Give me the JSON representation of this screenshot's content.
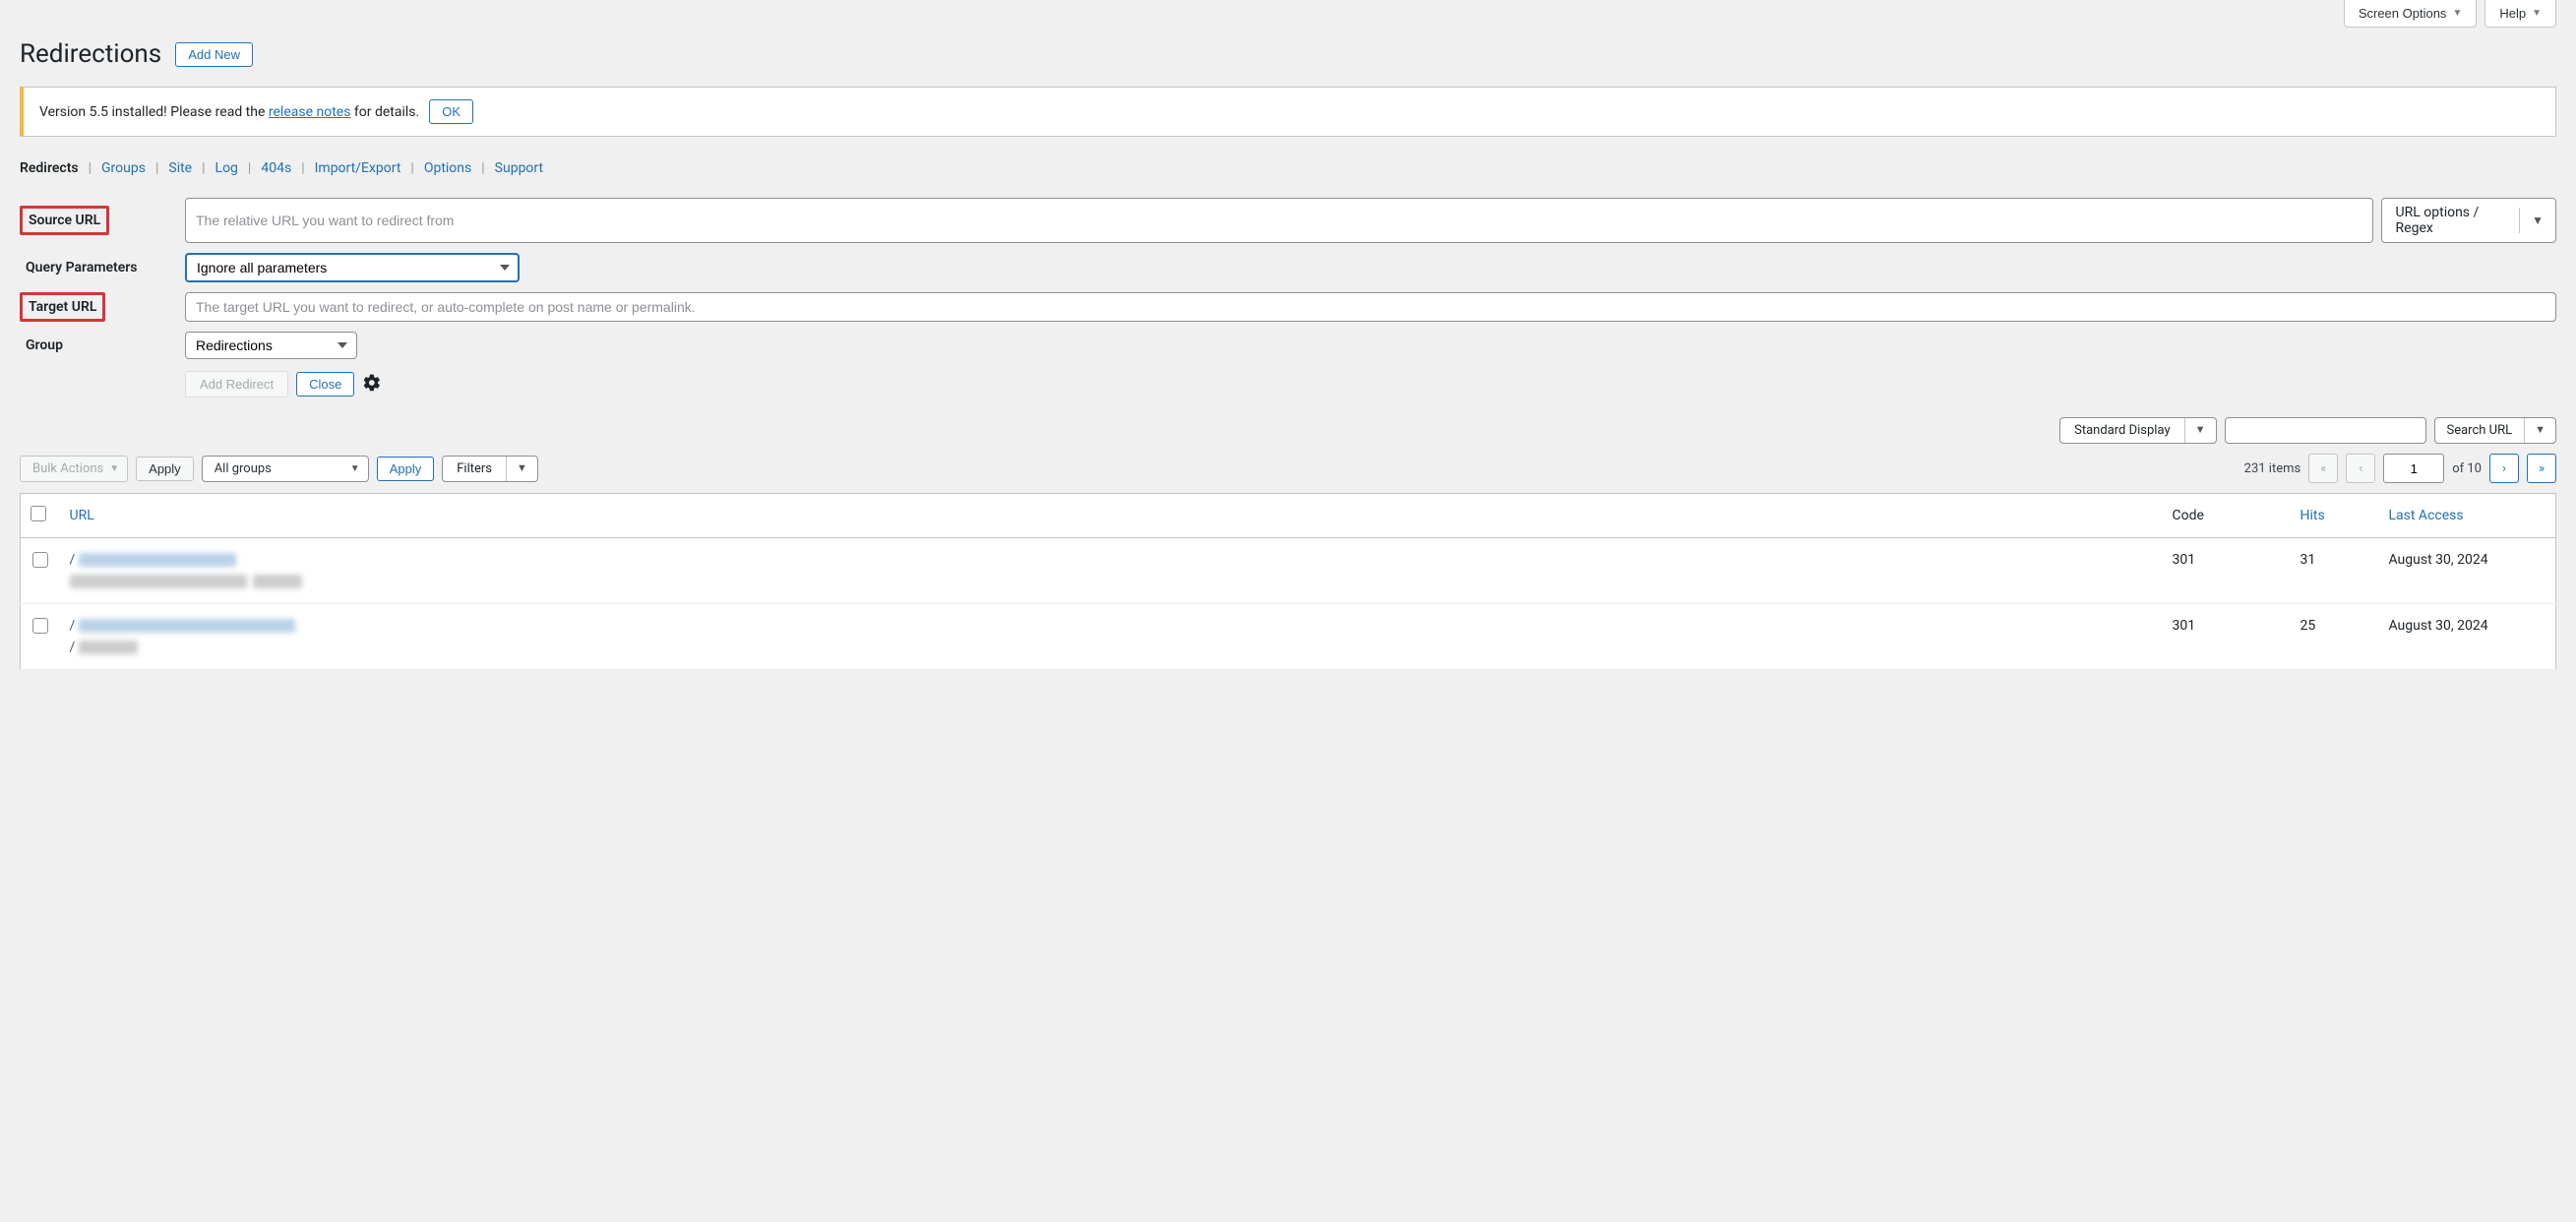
{
  "topTabs": {
    "screenOptions": "Screen Options",
    "help": "Help"
  },
  "header": {
    "title": "Redirections",
    "addNew": "Add New"
  },
  "notice": {
    "prefix": "Version 5.5 installed! Please read the ",
    "link": "release notes",
    "suffix": " for details.",
    "ok": "OK"
  },
  "subnav": [
    "Redirects",
    "Groups",
    "Site",
    "Log",
    "404s",
    "Import/Export",
    "Options",
    "Support"
  ],
  "subnavActive": 0,
  "form": {
    "sourceLabel": "Source URL",
    "sourcePlaceholder": "The relative URL you want to redirect from",
    "urlOptions": "URL options / Regex",
    "queryLabel": "Query Parameters",
    "querySelected": "Ignore all parameters",
    "targetLabel": "Target URL",
    "targetPlaceholder": "The target URL you want to redirect, or auto-complete on post name or permalink.",
    "groupLabel": "Group",
    "groupSelected": "Redirections",
    "addRedirect": "Add Redirect",
    "close": "Close"
  },
  "displayMode": "Standard Display",
  "searchBtn": "Search URL",
  "bulkActions": "Bulk Actions",
  "applyBtn": "Apply",
  "groupsFilter": "All groups",
  "applyFilter": "Apply",
  "filtersBtn": "Filters",
  "pagination": {
    "itemsText": "231 items",
    "page": "1",
    "ofText": "of 10"
  },
  "table": {
    "headers": {
      "url": "URL",
      "code": "Code",
      "hits": "Hits",
      "last": "Last Access"
    },
    "rows": [
      {
        "code": "301",
        "hits": "31",
        "last": "August 30, 2024"
      },
      {
        "code": "301",
        "hits": "25",
        "last": "August 30, 2024"
      }
    ]
  }
}
